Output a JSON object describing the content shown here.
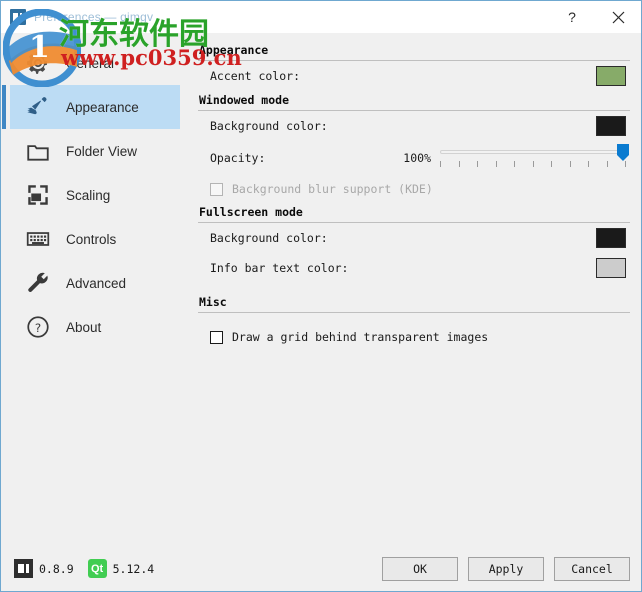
{
  "window": {
    "title": "Preferences — qimgv",
    "icon": "qimgv-logo-icon",
    "help_label": "?",
    "close_label": "✕"
  },
  "sidebar": {
    "items": [
      {
        "label": "General",
        "icon": "gear-icon",
        "selected": false
      },
      {
        "label": "Appearance",
        "icon": "paintbrush-icon",
        "selected": true
      },
      {
        "label": "Folder View",
        "icon": "folder-icon",
        "selected": false
      },
      {
        "label": "Scaling",
        "icon": "scaling-icon",
        "selected": false
      },
      {
        "label": "Controls",
        "icon": "keyboard-icon",
        "selected": false
      },
      {
        "label": "Advanced",
        "icon": "wrench-icon",
        "selected": false
      },
      {
        "label": "About",
        "icon": "question-icon",
        "selected": false
      }
    ]
  },
  "content": {
    "appearance": {
      "heading": "Appearance",
      "accent_color_label": "Accent color:",
      "accent_color_value": "#87ab69"
    },
    "windowed": {
      "heading": "Windowed mode",
      "background_color_label": "Background color:",
      "background_color_value": "#1a1a1a",
      "opacity_label": "Opacity:",
      "opacity_value": "100%",
      "opacity_percent": 100,
      "blur_label": "Background blur support (KDE)",
      "blur_checked": false,
      "blur_disabled": true
    },
    "fullscreen": {
      "heading": "Fullscreen mode",
      "background_color_label": "Background color:",
      "background_color_value": "#1a1a1a",
      "infobar_text_color_label": "Info bar text color:",
      "infobar_text_color_value": "#cccccc"
    },
    "misc": {
      "heading": "Misc",
      "grid_label": "Draw a grid behind transparent images",
      "grid_checked": false
    }
  },
  "footer": {
    "app_version": "0.8.9",
    "qt_badge_label": "Qt",
    "qt_version": "5.12.4",
    "ok_label": "OK",
    "apply_label": "Apply",
    "cancel_label": "Cancel"
  },
  "watermark": {
    "site_name": "河东软件园",
    "url": "www.pc0359.cn"
  }
}
